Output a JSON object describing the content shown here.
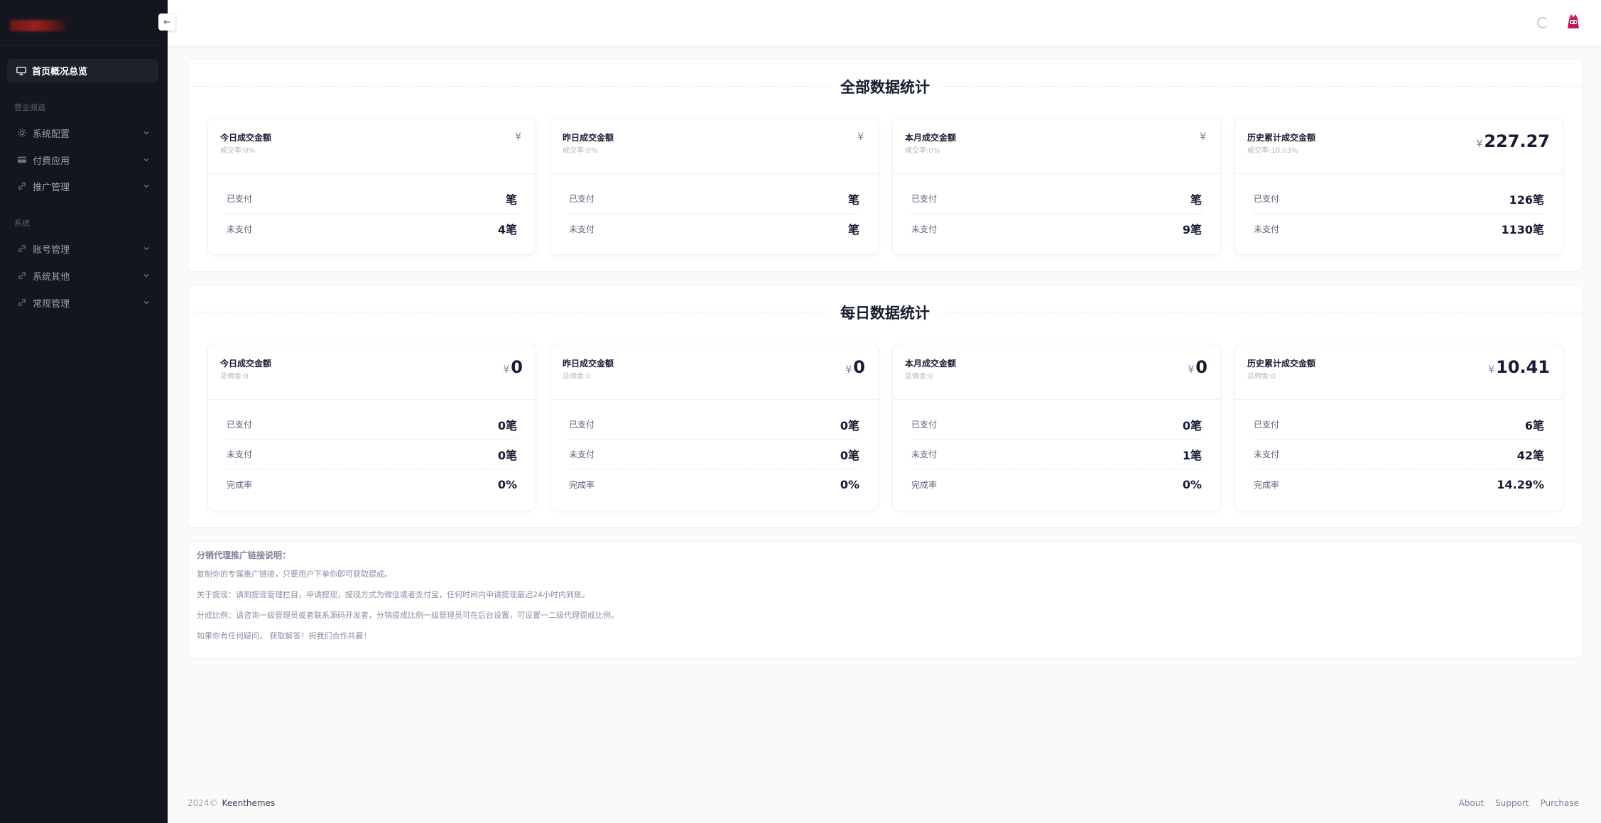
{
  "sidebar": {
    "active_item": "首页概况总览",
    "section1": "营业频道",
    "section1_items": [
      "系统配置",
      "付费应用",
      "推广管理"
    ],
    "section2": "系统",
    "section2_items": [
      "账号管理",
      "系统其他",
      "常规管理"
    ]
  },
  "panel1": {
    "title": "全部数据统计",
    "cards": [
      {
        "title": "今日成交金额",
        "sub": "成交率:0%",
        "currency": "¥",
        "amount": "",
        "rows": [
          {
            "label": "已支付",
            "value": "笔"
          },
          {
            "label": "未支付",
            "value": "4笔"
          }
        ]
      },
      {
        "title": "昨日成交金额",
        "sub": "成交率:0%",
        "currency": "¥",
        "amount": "",
        "rows": [
          {
            "label": "已支付",
            "value": "笔"
          },
          {
            "label": "未支付",
            "value": "笔"
          }
        ]
      },
      {
        "title": "本月成交金额",
        "sub": "成交率:0%",
        "currency": "¥",
        "amount": "",
        "rows": [
          {
            "label": "已支付",
            "value": "笔"
          },
          {
            "label": "未支付",
            "value": "9笔"
          }
        ]
      },
      {
        "title": "历史累计成交金额",
        "sub": "成交率:10.03%",
        "currency": "¥",
        "amount": "227.27",
        "rows": [
          {
            "label": "已支付",
            "value": "126笔"
          },
          {
            "label": "未支付",
            "value": "1130笔"
          }
        ]
      }
    ]
  },
  "panel2": {
    "title": "每日数据统计",
    "cards": [
      {
        "title": "今日成交金额",
        "sub": "总佣金:0",
        "currency": "¥",
        "amount": "0",
        "rows": [
          {
            "label": "已支付",
            "value": "0笔"
          },
          {
            "label": "未支付",
            "value": "0笔"
          },
          {
            "label": "完成率",
            "value": "0%"
          }
        ]
      },
      {
        "title": "昨日成交金额",
        "sub": "总佣金:0",
        "currency": "¥",
        "amount": "0",
        "rows": [
          {
            "label": "已支付",
            "value": "0笔"
          },
          {
            "label": "未支付",
            "value": "0笔"
          },
          {
            "label": "完成率",
            "value": "0%"
          }
        ]
      },
      {
        "title": "本月成交金额",
        "sub": "总佣金:0",
        "currency": "¥",
        "amount": "0",
        "rows": [
          {
            "label": "已支付",
            "value": "0笔"
          },
          {
            "label": "未支付",
            "value": "1笔"
          },
          {
            "label": "完成率",
            "value": "0%"
          }
        ]
      },
      {
        "title": "历史累计成交金额",
        "sub": "总佣金:0",
        "currency": "¥",
        "amount": "10.41",
        "rows": [
          {
            "label": "已支付",
            "value": "6笔"
          },
          {
            "label": "未支付",
            "value": "42笔"
          },
          {
            "label": "完成率",
            "value": "14.29%"
          }
        ]
      }
    ]
  },
  "note": {
    "title": "分销代理推广链接说明：",
    "lines": [
      "复制你的专属推广链接，只要用户下单你即可获取提成。",
      "关于提现：请到提现管理栏目，申请提现，提现方式为微信或者支付宝，任何时间内申请提现最迟24小时内到账。",
      "分成比例：请咨询一级管理员或者联系源码开发者，分销提成比例一级管理员可在后台设置，可设置一二级代理提成比例。",
      "如果你有任何疑问， 获取解答！祝我们合作共赢！"
    ]
  },
  "footer": {
    "year": "2024©",
    "brand": "Keenthemes",
    "links": [
      "About",
      "Support",
      "Purchase"
    ]
  }
}
